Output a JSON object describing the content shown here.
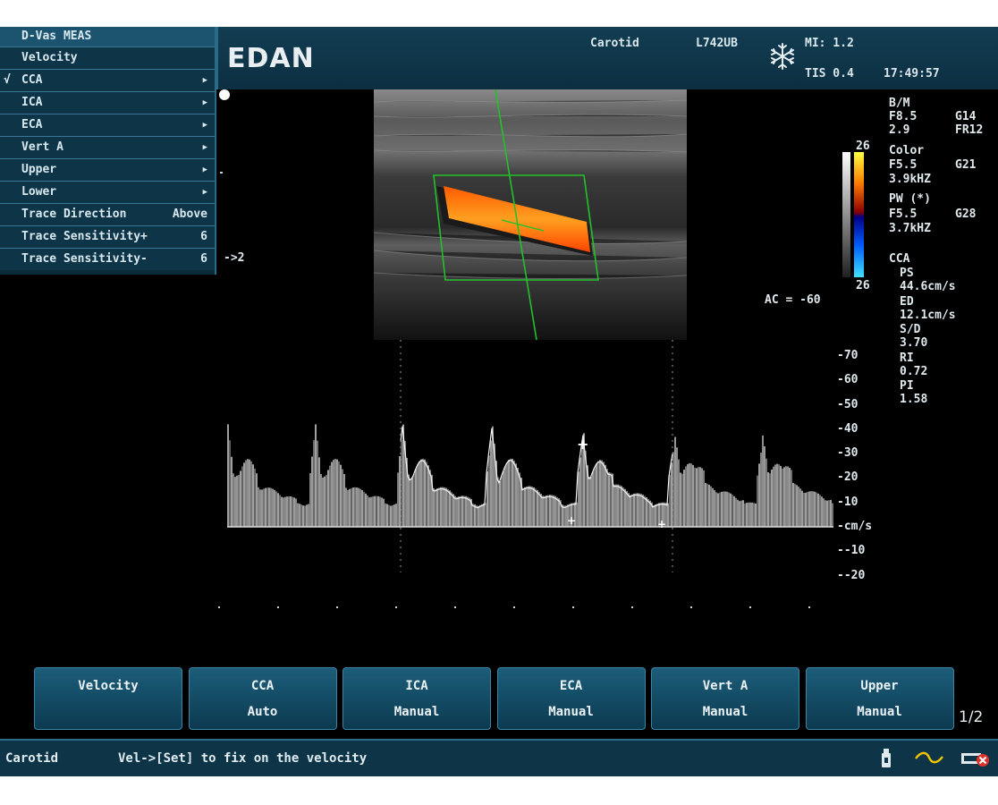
{
  "header": {
    "logo": "EDAN",
    "preset": "Carotid",
    "probe": "L742UB",
    "mi": "MI: 1.2",
    "tis": "TIS 0.4",
    "time": "17:49:57"
  },
  "menu": {
    "title": "D-Vas MEAS",
    "items": [
      {
        "label": "Velocity",
        "checked": false,
        "has_submenu": false,
        "value": ""
      },
      {
        "label": "CCA",
        "checked": true,
        "has_submenu": true,
        "value": ""
      },
      {
        "label": "ICA",
        "checked": false,
        "has_submenu": true,
        "value": ""
      },
      {
        "label": "ECA",
        "checked": false,
        "has_submenu": true,
        "value": ""
      },
      {
        "label": "Vert A",
        "checked": false,
        "has_submenu": true,
        "value": ""
      },
      {
        "label": "Upper",
        "checked": false,
        "has_submenu": true,
        "value": ""
      },
      {
        "label": "Lower",
        "checked": false,
        "has_submenu": true,
        "value": ""
      },
      {
        "label": "Trace Direction",
        "checked": false,
        "has_submenu": false,
        "value": "Above"
      },
      {
        "label": "Trace Sensitivity+",
        "checked": false,
        "has_submenu": false,
        "value": "6"
      },
      {
        "label": "Trace Sensitivity-",
        "checked": false,
        "has_submenu": false,
        "value": "6"
      }
    ],
    "check_glyph": "√",
    "arrow_glyph": "▶"
  },
  "params": {
    "bm_label": "B/M",
    "bm_f": "F8.5",
    "bm_g": "G14",
    "bm_d": "2.9",
    "bm_fr": "FR12",
    "color_label": "Color",
    "color_f": "F5.5",
    "color_g": "G21",
    "color_prf": "3.9kHZ",
    "pw_label": "PW (*)",
    "pw_f": "F5.5",
    "pw_g": "G28",
    "pw_prf": "3.7kHZ",
    "vessel": "CCA",
    "ps_label": "PS",
    "ps_value": "44.6cm/s",
    "ed_label": "ED",
    "ed_value": "12.1cm/s",
    "sd_label": "S/D",
    "sd_value": "3.70",
    "ri_label": "RI",
    "ri_value": "0.72",
    "pi_label": "PI",
    "pi_value": "1.58"
  },
  "colorbar": {
    "top_label": "26",
    "bottom_label": "26"
  },
  "angle_correction": "AC = -60",
  "depth_marker": "->2",
  "spectral": {
    "axis_labels": [
      "-70",
      "-60",
      "-50",
      "-40",
      "-30",
      "-20",
      "-10",
      "-cm/s",
      "--10",
      "--20"
    ],
    "axis_values": [
      70,
      60,
      50,
      40,
      30,
      20,
      10,
      0,
      -10,
      -20
    ]
  },
  "softkeys": [
    {
      "line1": "Velocity",
      "line2": ""
    },
    {
      "line1": "CCA",
      "line2": "Auto"
    },
    {
      "line1": "ICA",
      "line2": "Manual"
    },
    {
      "line1": "ECA",
      "line2": "Manual"
    },
    {
      "line1": "Vert A",
      "line2": "Manual"
    },
    {
      "line1": "Upper",
      "line2": "Manual"
    }
  ],
  "page_indicator": "1/2",
  "status": {
    "preset": "Carotid",
    "hint": "Vel->[Set] to fix on the velocity"
  },
  "colors": {
    "panel": "#0e3448",
    "accent": "#2b6a86",
    "doppler_box": "#22c12a",
    "flow": "#ff7a00"
  }
}
